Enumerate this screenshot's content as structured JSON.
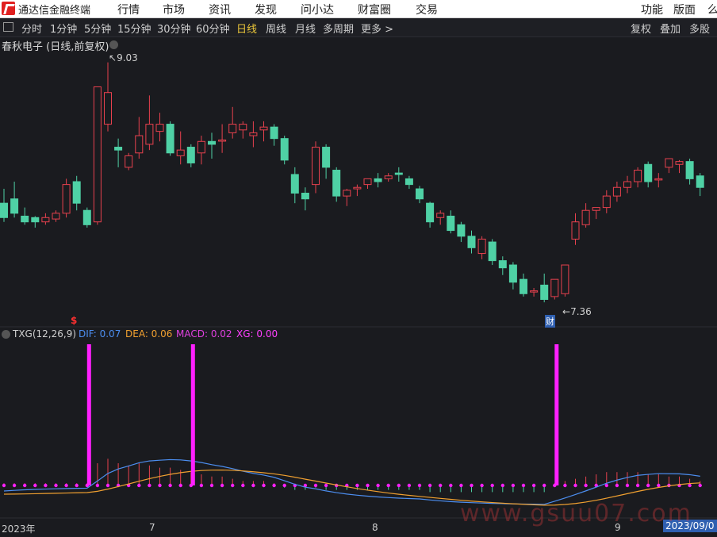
{
  "menubar": {
    "app_title": "通达信金融终端",
    "items": [
      "行情",
      "市场",
      "资讯",
      "发现",
      "问小达",
      "财富圈",
      "交易"
    ],
    "right_items": [
      "功能",
      "版面",
      "么"
    ]
  },
  "toolbar": {
    "periods": [
      "分时",
      "1分钟",
      "5分钟",
      "15分钟",
      "30分钟",
      "60分钟",
      "日线",
      "周线",
      "月线",
      "多周期",
      "更多 >"
    ],
    "active_period": "日线",
    "right_buttons": [
      "复权",
      "叠加",
      "多股"
    ]
  },
  "chart_title": "春秋电子 (日线,前复权)",
  "high_label": "9.03",
  "low_label": "7.36",
  "markers": {
    "signal": "$",
    "finance": "财"
  },
  "indicator": {
    "name": "TXG(12,26,9)",
    "dif": "DIF: 0.07",
    "dea": "DEA: 0.06",
    "macd": "MACD: 0.02",
    "xg": "XG: 0.00"
  },
  "colors": {
    "up": "#e8414e",
    "down": "#4fd1a5",
    "dif": "#4c8ef0",
    "dea": "#f0a030",
    "macd_label": "#e040e0",
    "xg": "#ff20ff",
    "signal": "#ff3030",
    "bg": "#1a1b1f"
  },
  "xaxis": {
    "labels": [
      "2023年",
      "7",
      "8",
      "9"
    ],
    "badge": "2023/09/0"
  },
  "watermark": "www.gsuu07.com",
  "chart_data": {
    "type": "candlestick",
    "price_candles_ohlc": [
      [
        8.05,
        8.15,
        7.95,
        7.92
      ],
      [
        8.08,
        8.2,
        7.98,
        7.95
      ],
      [
        7.96,
        8.02,
        7.92,
        7.9
      ],
      [
        7.95,
        7.96,
        7.92,
        7.88
      ],
      [
        7.92,
        7.98,
        7.95,
        7.9
      ],
      [
        7.94,
        8.0,
        7.98,
        7.92
      ],
      [
        7.98,
        8.22,
        8.18,
        7.95
      ],
      [
        8.2,
        8.24,
        8.05,
        8.0
      ],
      [
        8.0,
        8.02,
        7.9,
        7.88
      ],
      [
        7.92,
        8.85,
        8.86,
        7.9
      ],
      [
        8.6,
        9.03,
        8.82,
        8.55
      ],
      [
        8.44,
        8.5,
        8.42,
        8.3
      ],
      [
        8.3,
        8.4,
        8.38,
        8.28
      ],
      [
        8.4,
        8.65,
        8.52,
        8.36
      ],
      [
        8.46,
        8.8,
        8.6,
        8.42
      ],
      [
        8.55,
        8.68,
        8.6,
        8.48
      ],
      [
        8.6,
        8.62,
        8.4,
        8.38
      ],
      [
        8.38,
        8.55,
        8.42,
        8.32
      ],
      [
        8.44,
        8.46,
        8.33,
        8.3
      ],
      [
        8.4,
        8.52,
        8.48,
        8.32
      ],
      [
        8.48,
        8.54,
        8.46,
        8.36
      ],
      [
        8.49,
        8.6,
        8.49,
        8.4
      ],
      [
        8.54,
        8.72,
        8.6,
        8.5
      ],
      [
        8.56,
        8.62,
        8.6,
        8.5
      ],
      [
        8.52,
        8.62,
        8.54,
        8.44
      ],
      [
        8.56,
        8.62,
        8.58,
        8.48
      ],
      [
        8.58,
        8.6,
        8.5,
        8.45
      ],
      [
        8.5,
        8.52,
        8.35,
        8.32
      ],
      [
        8.25,
        8.3,
        8.12,
        8.05
      ],
      [
        8.12,
        8.16,
        8.08,
        8.0
      ],
      [
        8.18,
        8.48,
        8.44,
        8.12
      ],
      [
        8.44,
        8.46,
        8.3,
        8.22
      ],
      [
        8.28,
        8.3,
        8.1,
        8.06
      ],
      [
        8.1,
        8.15,
        8.14,
        8.03
      ],
      [
        8.15,
        8.18,
        8.16,
        8.1
      ],
      [
        8.18,
        8.2,
        8.22,
        8.15
      ],
      [
        8.22,
        8.26,
        8.2,
        8.16
      ],
      [
        8.22,
        8.26,
        8.24,
        8.2
      ],
      [
        8.26,
        8.3,
        8.25,
        8.2
      ],
      [
        8.22,
        8.24,
        8.18,
        8.15
      ],
      [
        8.15,
        8.17,
        8.08,
        8.05
      ],
      [
        8.05,
        8.06,
        7.92,
        7.88
      ],
      [
        7.95,
        8.0,
        7.98,
        7.9
      ],
      [
        7.96,
        8.0,
        7.86,
        7.84
      ],
      [
        7.9,
        7.92,
        7.82,
        7.78
      ],
      [
        7.82,
        7.86,
        7.74,
        7.7
      ],
      [
        7.7,
        7.82,
        7.8,
        7.66
      ],
      [
        7.78,
        7.8,
        7.65,
        7.62
      ],
      [
        7.65,
        7.68,
        7.6,
        7.55
      ],
      [
        7.62,
        7.64,
        7.5,
        7.45
      ],
      [
        7.52,
        7.56,
        7.42,
        7.4
      ],
      [
        7.44,
        7.46,
        7.44,
        7.4
      ],
      [
        7.48,
        7.56,
        7.38,
        7.36
      ],
      [
        7.4,
        7.5,
        7.52,
        7.38
      ],
      [
        7.42,
        7.58,
        7.62,
        7.4
      ],
      [
        7.8,
        7.98,
        7.92,
        7.76
      ],
      [
        7.9,
        8.05,
        8.0,
        7.88
      ],
      [
        8.0,
        8.02,
        8.02,
        7.94
      ],
      [
        8.02,
        8.14,
        8.1,
        7.98
      ],
      [
        8.1,
        8.2,
        8.16,
        8.06
      ],
      [
        8.16,
        8.24,
        8.2,
        8.12
      ],
      [
        8.2,
        8.3,
        8.28,
        8.16
      ],
      [
        8.32,
        8.34,
        8.2,
        8.16
      ],
      [
        8.22,
        8.26,
        8.22,
        8.16
      ],
      [
        8.3,
        8.34,
        8.36,
        8.26
      ],
      [
        8.32,
        8.35,
        8.34,
        8.26
      ],
      [
        8.34,
        8.36,
        8.22,
        8.18
      ],
      [
        8.24,
        8.26,
        8.16,
        8.1
      ]
    ],
    "macd_bars": [
      0.01,
      0.01,
      0.01,
      0.01,
      0.01,
      0.01,
      0.01,
      0.01,
      0.01,
      0.1,
      0.12,
      0.1,
      0.09,
      0.1,
      0.09,
      0.08,
      0.08,
      0.07,
      0.06,
      0.05,
      0.04,
      0.04,
      0.03,
      0.02,
      0.02,
      0.02,
      0.01,
      -0.01,
      -0.02,
      -0.02,
      -0.01,
      -0.02,
      -0.02,
      -0.02,
      -0.02,
      -0.02,
      -0.02,
      -0.02,
      -0.02,
      -0.02,
      -0.02,
      -0.03,
      -0.03,
      -0.03,
      -0.03,
      -0.03,
      -0.03,
      -0.03,
      -0.03,
      -0.03,
      -0.03,
      -0.03,
      -0.03,
      0.01,
      0.02,
      0.03,
      0.04,
      0.05,
      0.06,
      0.06,
      0.06,
      0.06,
      0.05,
      0.05,
      0.04,
      0.04,
      0.03,
      0.02
    ],
    "xg_signal_indices": [
      8,
      18,
      53
    ]
  }
}
